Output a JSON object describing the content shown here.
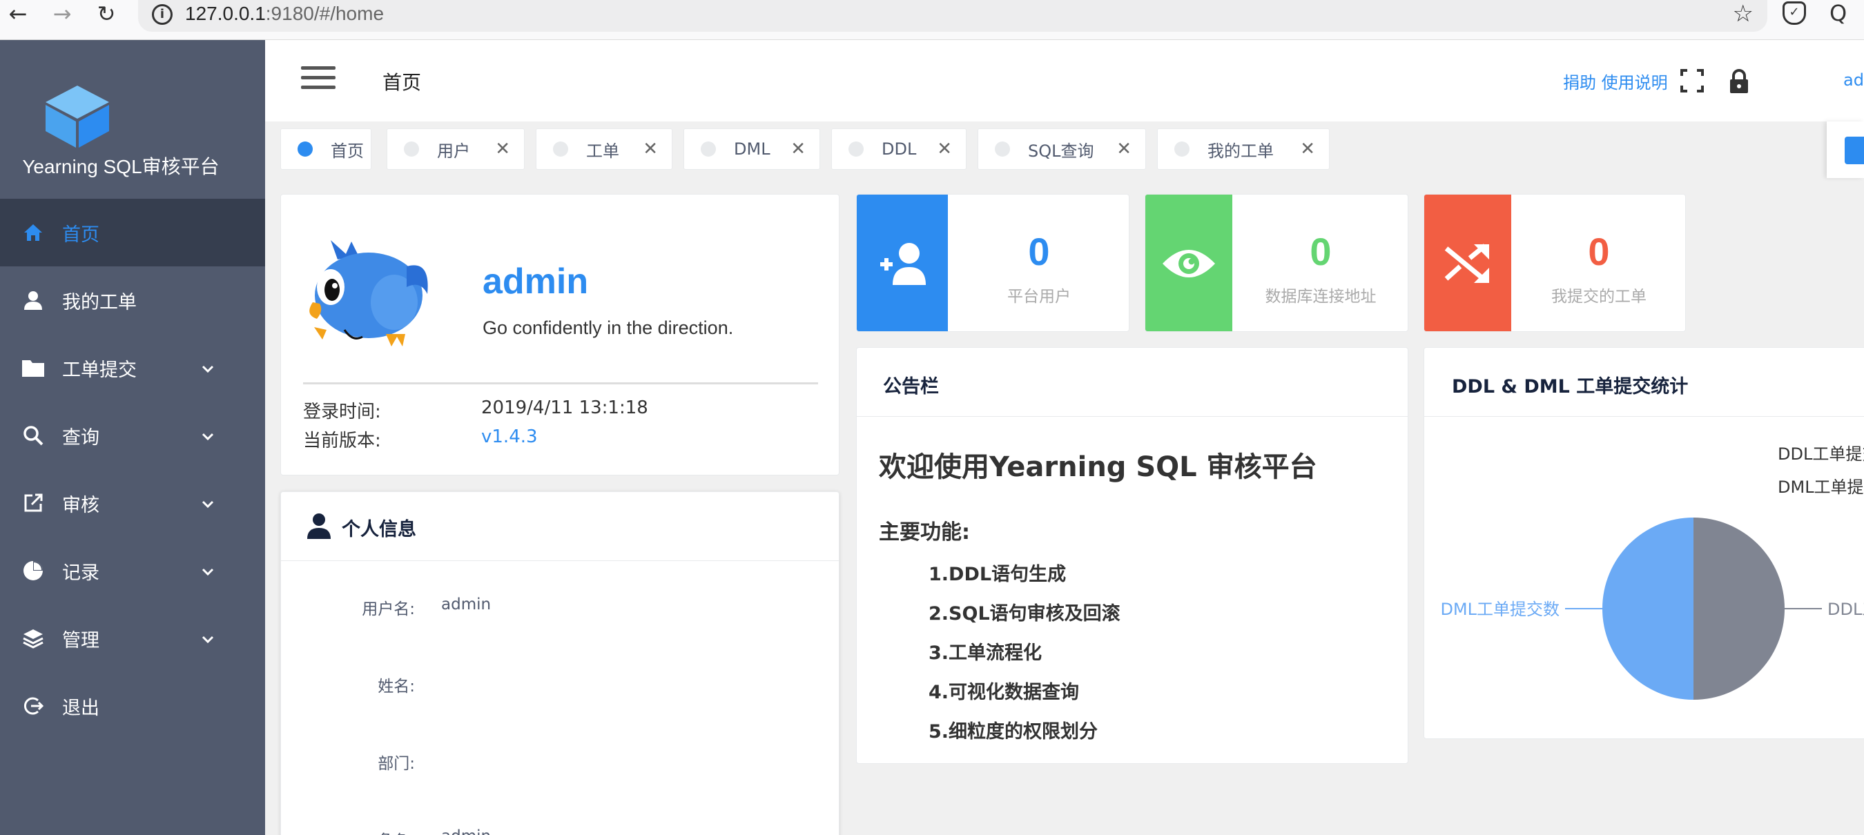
{
  "browser": {
    "url_host": "127.0.0.1",
    "url_rest": ":9180/#/home"
  },
  "sidebar": {
    "logo_title": "Yearning SQL审核平台",
    "items": [
      {
        "label": "首页",
        "icon": "home-icon",
        "active": true,
        "has_children": false
      },
      {
        "label": "我的工单",
        "icon": "user-icon",
        "active": false,
        "has_children": false
      },
      {
        "label": "工单提交",
        "icon": "folder-icon",
        "active": false,
        "has_children": true
      },
      {
        "label": "查询",
        "icon": "search-icon",
        "active": false,
        "has_children": true
      },
      {
        "label": "审核",
        "icon": "external-link-icon",
        "active": false,
        "has_children": true
      },
      {
        "label": "记录",
        "icon": "pie-icon",
        "active": false,
        "has_children": true
      },
      {
        "label": "管理",
        "icon": "layers-icon",
        "active": false,
        "has_children": true
      },
      {
        "label": "退出",
        "icon": "logout-icon",
        "active": false,
        "has_children": false
      }
    ]
  },
  "header": {
    "title": "首页",
    "links": "捐助 使用说明",
    "user": "ad"
  },
  "tags": [
    {
      "label": "首页",
      "active": true,
      "closable": false
    },
    {
      "label": "用户",
      "active": false,
      "closable": true
    },
    {
      "label": "工单",
      "active": false,
      "closable": true
    },
    {
      "label": "DML",
      "active": false,
      "closable": true
    },
    {
      "label": "DDL",
      "active": false,
      "closable": true
    },
    {
      "label": "SQL查询",
      "active": false,
      "closable": true
    },
    {
      "label": "我的工单",
      "active": false,
      "closable": true
    }
  ],
  "tag_close_glyph": "✕",
  "profile": {
    "name": "admin",
    "motto": "Go confidently in the direction.",
    "login_time_label": "登录时间:",
    "login_time": "2019/4/11 13:1:18",
    "version_label": "当前版本:",
    "version": "v1.4.3"
  },
  "info": {
    "title": "个人信息",
    "fields": [
      {
        "label": "用户名:",
        "value": "admin"
      },
      {
        "label": "姓名:",
        "value": ""
      },
      {
        "label": "部门:",
        "value": ""
      },
      {
        "label": "角色:",
        "value": "admin"
      }
    ]
  },
  "stats": [
    {
      "value": "0",
      "label": "平台用户",
      "color": "#2d8cf0",
      "icon": "add-user-icon"
    },
    {
      "value": "0",
      "label": "数据库连接地址",
      "color": "#64d572",
      "icon": "eye-icon"
    },
    {
      "value": "0",
      "label": "我提交的工单",
      "color": "#f25e43",
      "icon": "shuffle-icon"
    }
  ],
  "notice": {
    "title": "公告栏",
    "heading": "欢迎使用Yearning SQL 审核平台",
    "subheading": "主要功能:",
    "features": [
      "1.DDL语句生成",
      "2.SQL语句审核及回滚",
      "3.工单流程化",
      "4.可视化数据查询",
      "5.细粒度的权限划分"
    ]
  },
  "chart_data": {
    "type": "pie",
    "title": "DDL & DML 工单提交统计",
    "legend": [
      "DDL工单提交数",
      "DML工单提交数"
    ],
    "slices": [
      {
        "name": "DDL工单提交数",
        "value": 1,
        "color": "#808592"
      },
      {
        "name": "DML工单提交数",
        "value": 1,
        "color": "#6baaf5"
      }
    ],
    "legend_placement": "top-right"
  }
}
